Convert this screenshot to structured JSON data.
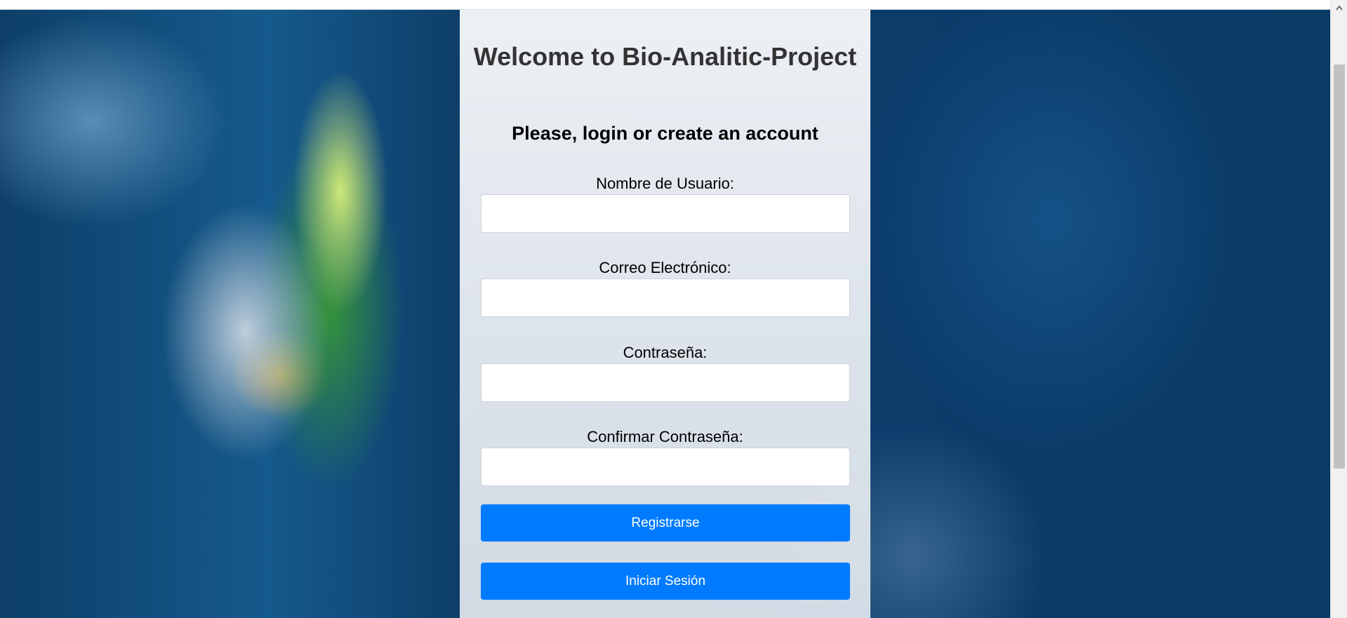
{
  "page": {
    "title": "Welcome to Bio-Analitic-Project",
    "subtitle": "Please, login or create an account"
  },
  "form": {
    "fields": [
      {
        "label": "Nombre de Usuario:",
        "value": ""
      },
      {
        "label": "Correo Electrónico:",
        "value": ""
      },
      {
        "label": "Contraseña:",
        "value": ""
      },
      {
        "label": "Confirmar Contraseña:",
        "value": ""
      }
    ],
    "register_label": "Registrarse",
    "login_label": "Iniciar Sesión"
  },
  "colors": {
    "primary_button": "#007bff",
    "title_text": "#333333",
    "panel_background": "#f1f4f8",
    "page_background": "#0b3c6b"
  },
  "icons": {
    "scroll_up": "chevron-up-icon"
  }
}
